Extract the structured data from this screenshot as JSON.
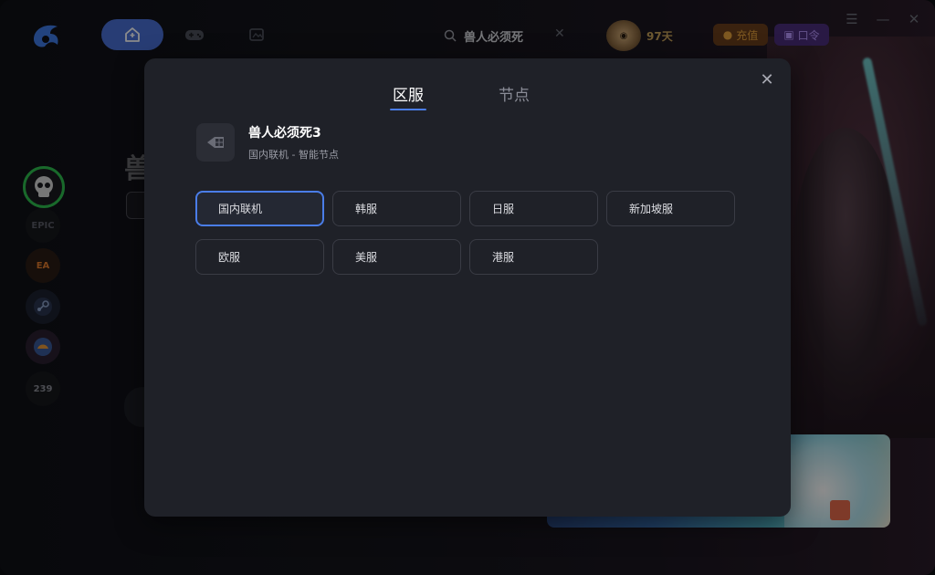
{
  "header": {
    "search_text": "兽人必须死",
    "vip_days": "97天",
    "recharge_label": "充值",
    "code_label": "口令"
  },
  "hero": {
    "title_fragment": "兽"
  },
  "sidebar": {
    "items": [
      {
        "name": "orcs-must-die",
        "label": ""
      },
      {
        "name": "epic",
        "label": "EPIC"
      },
      {
        "name": "ea",
        "label": "EA"
      },
      {
        "name": "steam",
        "label": ""
      },
      {
        "name": "game-platform",
        "label": ""
      },
      {
        "name": "count-239",
        "label": "239"
      }
    ]
  },
  "modal": {
    "tabs": [
      "区服",
      "节点"
    ],
    "active_tab": 0,
    "game": {
      "name": "兽人必须死3",
      "subtitle": "国内联机 - 智能节点"
    },
    "servers": [
      "国内联机",
      "韩服",
      "日服",
      "新加坡服",
      "欧服",
      "美服",
      "港服"
    ],
    "selected_server": 0
  },
  "colors": {
    "accent": "#4a7de8",
    "modal_bg": "#1f2128",
    "recharge": "#e7a23c",
    "code": "#b997ff"
  }
}
